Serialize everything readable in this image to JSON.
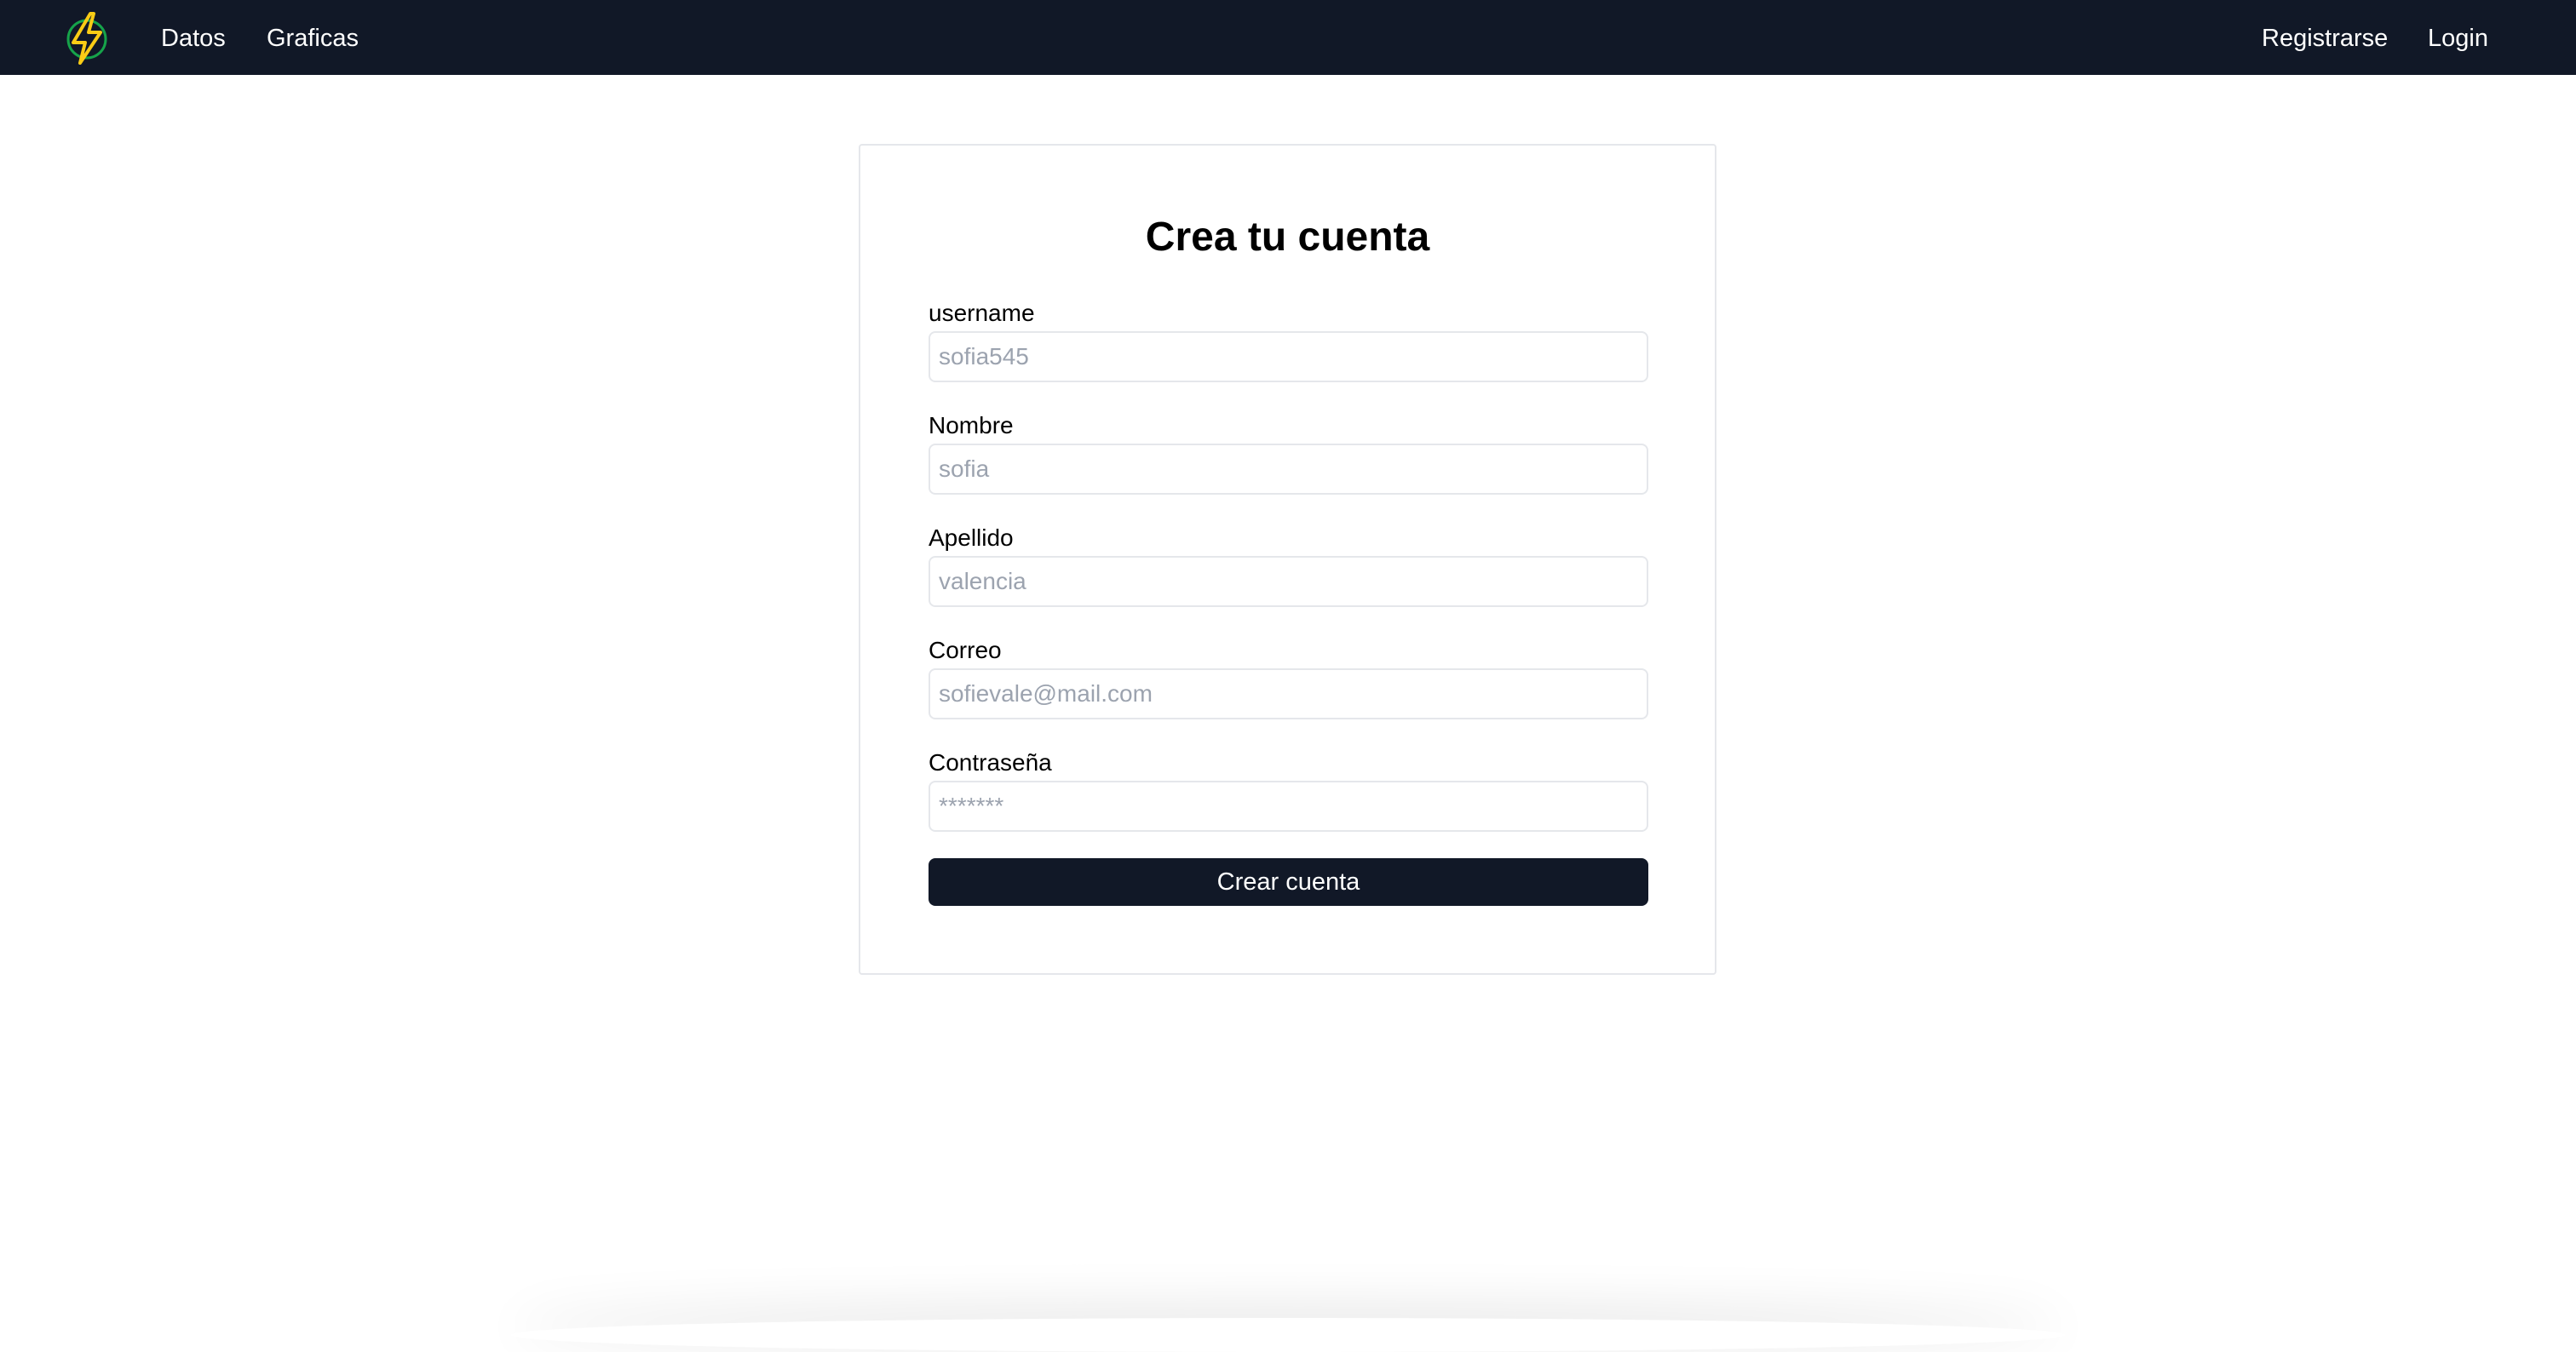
{
  "navbar": {
    "logo_icon": "lightning-bolt-icon",
    "links_left": [
      "Datos",
      "Graficas"
    ],
    "links_right": [
      "Registrarse",
      "Login"
    ]
  },
  "form": {
    "title": "Crea tu cuenta",
    "fields": [
      {
        "label": "username",
        "placeholder": "sofia545",
        "value": ""
      },
      {
        "label": "Nombre",
        "placeholder": "sofia",
        "value": ""
      },
      {
        "label": "Apellido",
        "placeholder": "valencia",
        "value": ""
      },
      {
        "label": "Correo",
        "placeholder": "sofievale@mail.com",
        "value": ""
      },
      {
        "label": "Contraseña",
        "placeholder": "*******",
        "value": ""
      }
    ],
    "submit_label": "Crear cuenta"
  },
  "colors": {
    "navbar_bg": "#111827",
    "button_bg": "#111827",
    "logo_bolt": "#facc15",
    "logo_ring": "#16a34a",
    "input_border": "#e5e7eb",
    "placeholder": "#9ca3af"
  }
}
